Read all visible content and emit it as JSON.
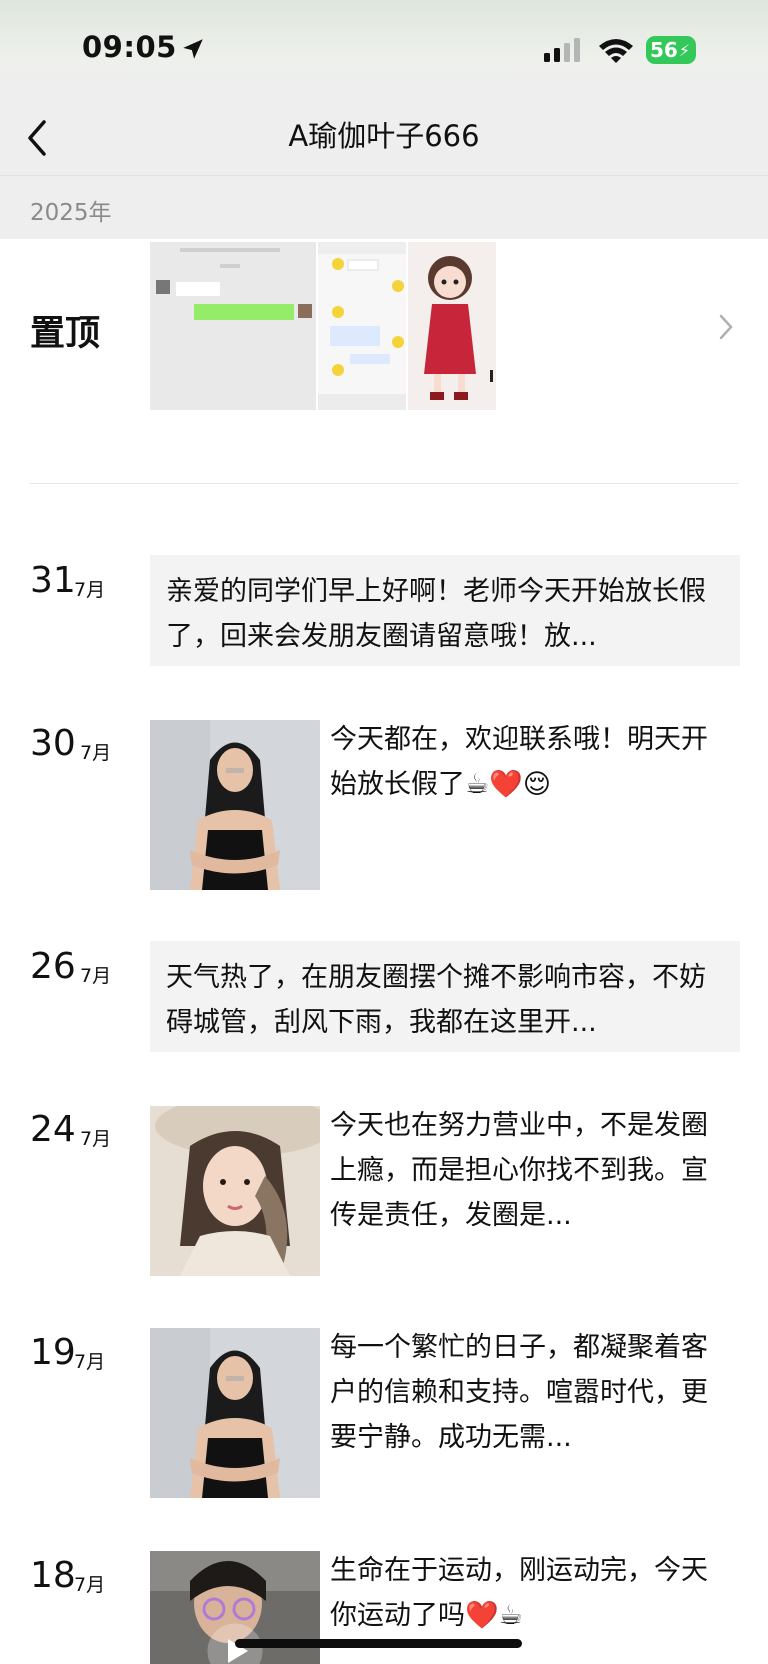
{
  "status_bar": {
    "time": "09:05",
    "battery": "56"
  },
  "header": {
    "title": "A瑜伽叶子666"
  },
  "year_label": "2025年",
  "pinned": {
    "label": "置顶"
  },
  "posts": [
    {
      "day": "31",
      "month": "7月",
      "text": "亲爱的同学们早上好啊！老师今天开始放长假了，回来会发朋友圈请留意哦！放..."
    },
    {
      "day": "30",
      "month": "7月",
      "text": "今天都在，欢迎联系哦！明天开始放长假了☕❤️😌"
    },
    {
      "day": "26",
      "month": "7月",
      "text": "天气热了，在朋友圈摆个摊不影响市容，不妨碍城管，刮风下雨，我都在这里开..."
    },
    {
      "day": "24",
      "month": "7月",
      "text": "今天也在努力营业中，不是发圈上瘾，而是担心你找不到我。宣传是责任，发圈是..."
    },
    {
      "day": "19",
      "month": "7月",
      "text": "每一个繁忙的日子，都凝聚着客户的信赖和支持。喧嚣时代，更要宁静。成功无需..."
    },
    {
      "day": "18",
      "month": "7月",
      "text": "生命在于运动，刚运动完，今天你运动了吗❤️☕"
    }
  ],
  "colors": {
    "accent_green": "#34c759",
    "bg_gray": "#eeeeee",
    "text_box_bg": "#f3f3f3"
  }
}
